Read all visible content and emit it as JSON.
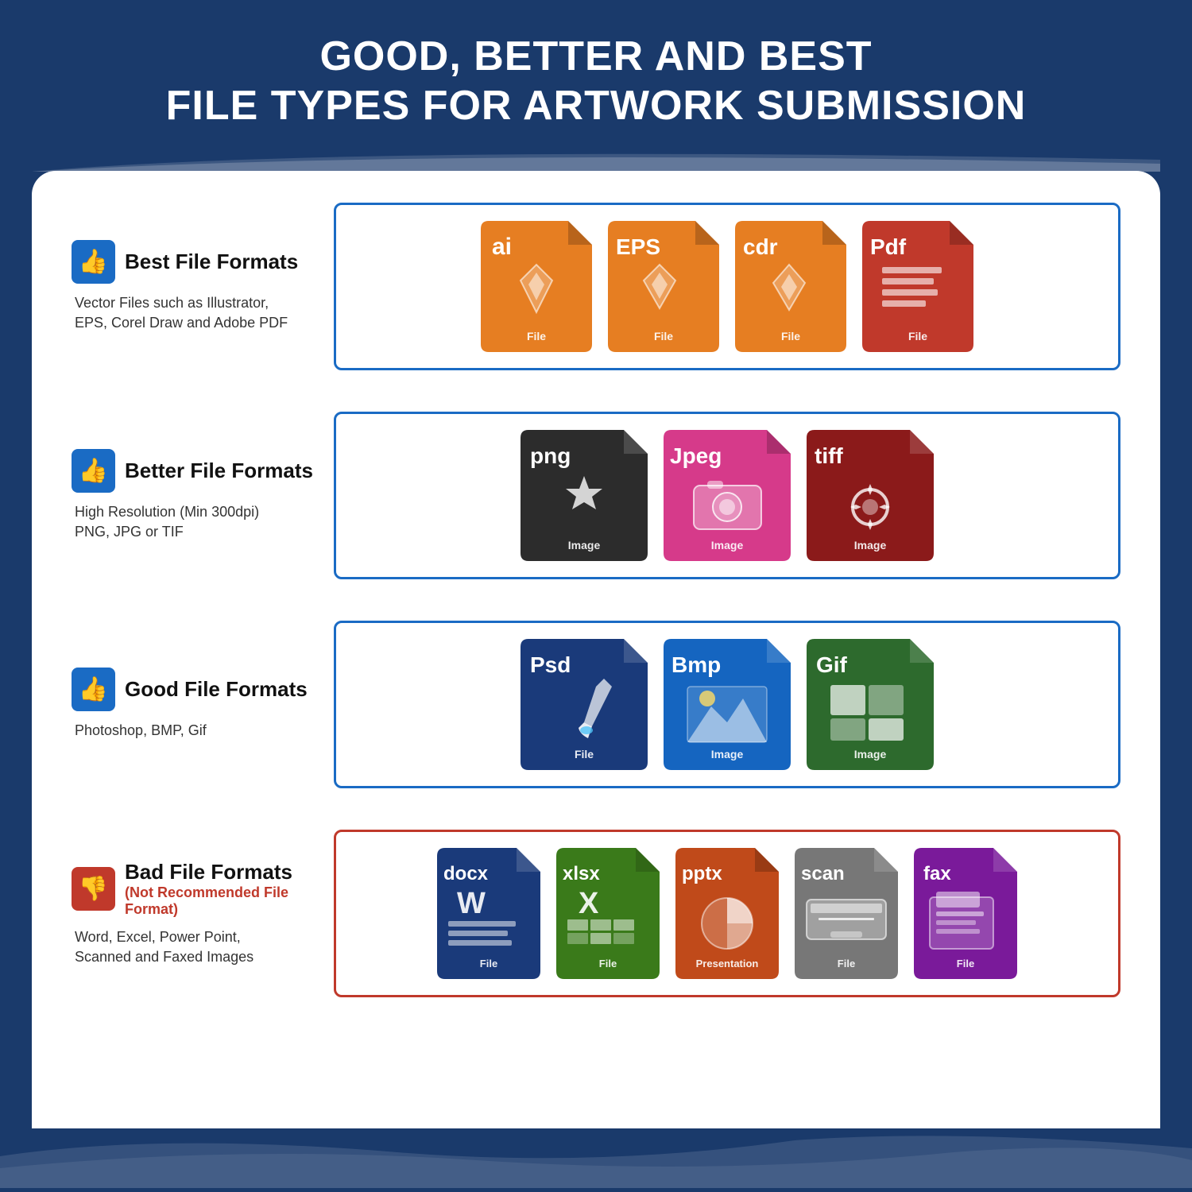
{
  "header": {
    "line1": "GOOD, BETTER AND BEST",
    "line2": "FILE TYPES FOR ARTWORK SUBMISSION"
  },
  "sections": [
    {
      "id": "best",
      "rating": "best",
      "thumb": "up",
      "title": "Best File Formats",
      "subtitle": null,
      "description": "Vector Files such as Illustrator,\nEPS, Corel Draw and Adobe PDF",
      "borderColor": "#1a6bc4",
      "files": [
        {
          "ext": "ai",
          "label": "File",
          "color": "fi-ai",
          "icon": "pen"
        },
        {
          "ext": "EPS",
          "label": "File",
          "color": "fi-eps",
          "icon": "pen"
        },
        {
          "ext": "cdr",
          "label": "File",
          "color": "fi-cdr",
          "icon": "pen"
        },
        {
          "ext": "Pdf",
          "label": "File",
          "color": "fi-pdf",
          "icon": "doc"
        }
      ]
    },
    {
      "id": "better",
      "rating": "better",
      "thumb": "up",
      "title": "Better File Formats",
      "subtitle": null,
      "description": "High Resolution (Min 300dpi)\nPNG, JPG or TIF",
      "borderColor": "#1a6bc4",
      "files": [
        {
          "ext": "png",
          "label": "Image",
          "color": "fi-png",
          "icon": "star"
        },
        {
          "ext": "Jpeg",
          "label": "Image",
          "color": "fi-jpeg",
          "icon": "camera"
        },
        {
          "ext": "tiff",
          "label": "Image",
          "color": "fi-tiff",
          "icon": "gear"
        }
      ]
    },
    {
      "id": "good",
      "rating": "good",
      "thumb": "up",
      "title": "Good File Formats",
      "subtitle": null,
      "description": "Photoshop, BMP, Gif",
      "borderColor": "#1a6bc4",
      "files": [
        {
          "ext": "Psd",
          "label": "File",
          "color": "fi-psd",
          "icon": "brush"
        },
        {
          "ext": "Bmp",
          "label": "Image",
          "color": "fi-bmp",
          "icon": "landscape"
        },
        {
          "ext": "Gif",
          "label": "Image",
          "color": "fi-gif",
          "icon": "grid"
        }
      ]
    },
    {
      "id": "bad",
      "rating": "bad",
      "thumb": "down",
      "title": "Bad File Formats",
      "subtitle": "(Not Recommended File Format)",
      "description": "Word, Excel, Power Point,\nScanned and Faxed Images",
      "borderColor": "#c0392b",
      "files": [
        {
          "ext": "docx",
          "label": "File",
          "color": "fi-docx",
          "icon": "word"
        },
        {
          "ext": "xlsx",
          "label": "File",
          "color": "fi-xlsx",
          "icon": "excel"
        },
        {
          "ext": "pptx",
          "label": "Presentation",
          "color": "fi-pptx",
          "icon": "ppt"
        },
        {
          "ext": "scan",
          "label": "File",
          "color": "fi-scan",
          "icon": "scanner"
        },
        {
          "ext": "fax",
          "label": "File",
          "color": "fi-fax",
          "icon": "fax"
        }
      ]
    }
  ]
}
